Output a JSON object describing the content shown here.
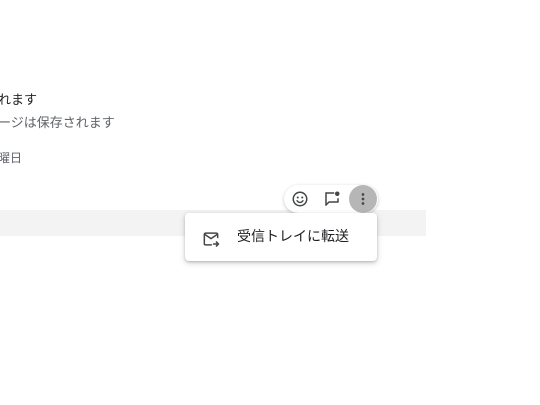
{
  "message": {
    "line1": "れます",
    "line2": "ージは保存されます",
    "line3": "曜日"
  },
  "actions": [
    {
      "icon": "emoji-icon"
    },
    {
      "icon": "flag-comment-icon"
    },
    {
      "icon": "more-vert-icon",
      "active": true
    }
  ],
  "context_menu": {
    "items": [
      {
        "icon": "forward-to-inbox-icon",
        "label": "受信トレイに転送"
      }
    ]
  }
}
